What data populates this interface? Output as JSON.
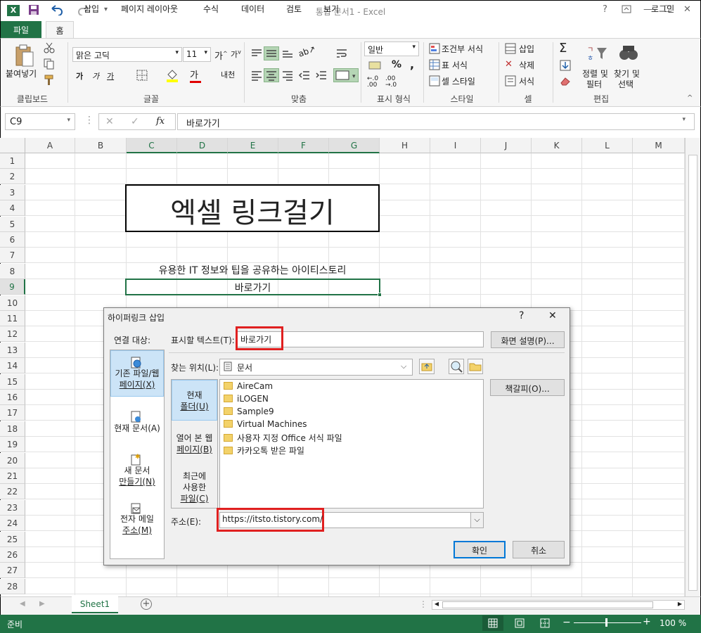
{
  "app": {
    "title": "통합 문서1 - Excel",
    "signin": "로그인"
  },
  "tabs": [
    "파일",
    "홈",
    "삽입",
    "페이지 레이아웃",
    "수식",
    "데이터",
    "검토",
    "보기"
  ],
  "ribbon": {
    "paste": "붙여넣기",
    "clipboard": "클립보드",
    "font_name": "맑은 고딕",
    "font_size": "11",
    "font_group": "글꼴",
    "align_group": "맞춤",
    "number_format": "일반",
    "number_group": "표시 형식",
    "cond_format": "조건부 서식",
    "table_format": "표 서식",
    "cell_style": "셀 스타일",
    "style_group": "스타일",
    "insert": "삽입",
    "delete": "삭제",
    "format": "서식",
    "cell_group": "셀",
    "sort_filter_1": "정렬 및",
    "sort_filter_2": "필터",
    "find_1": "찾기 및",
    "find_2": "선택",
    "edit_group": "편집",
    "bold": "가",
    "italic": "가",
    "underline": "가",
    "percent": "%",
    "comma": ","
  },
  "formula_bar": {
    "name_box": "C9",
    "fx": "fx",
    "content": "바로가기"
  },
  "columns": [
    "A",
    "B",
    "C",
    "D",
    "E",
    "F",
    "G",
    "H",
    "I",
    "J",
    "K",
    "L",
    "M"
  ],
  "rows": [
    "1",
    "2",
    "3",
    "4",
    "5",
    "6",
    "7",
    "8",
    "9",
    "10",
    "11",
    "12",
    "13",
    "14",
    "15",
    "16",
    "17",
    "18",
    "19",
    "20",
    "21",
    "22",
    "23",
    "24",
    "25",
    "26",
    "27",
    "28"
  ],
  "cells": {
    "title": "엑셀 링크걸기",
    "row8": "유용한 IT 정보와 팁을 공유하는 아이티스토리",
    "c9": "바로가기"
  },
  "sheet": {
    "name": "Sheet1"
  },
  "status": {
    "ready": "준비",
    "zoom": "100 %"
  },
  "dialog": {
    "title": "하이퍼링크 삽입",
    "help": "?",
    "close": "✕",
    "link_to": "연결 대상:",
    "nav": [
      {
        "l1": "기존 파일/웹",
        "l2": "페이지(X)"
      },
      {
        "l1": "현재 문서(A)",
        "l2": ""
      },
      {
        "l1": "새 문서",
        "l2": "만들기(N)"
      },
      {
        "l1": "전자 메일",
        "l2": "주소(M)"
      }
    ],
    "display_label": "표시할 텍스트(T):",
    "display_value": "바로가기",
    "screentip": "화면 설명(P)...",
    "look_in_label": "찾는 위치(L):",
    "look_in_value": "문서",
    "bookmark": "책갈피(O)...",
    "mid_nav": [
      {
        "l1": "현재",
        "l2": "폴더(U)",
        "l3": ""
      },
      {
        "l1": "열어 본 웹",
        "l2": "페이지(B)",
        "l3": ""
      },
      {
        "l1": "최근에",
        "l2": "사용한",
        "l3": "파일(C)"
      }
    ],
    "files": [
      "AireCam",
      "iLOGEN",
      "Sample9",
      "Virtual Machines",
      "사용자 지정 Office 서식 파일",
      "카카오톡 받은 파일"
    ],
    "address_label": "주소(E):",
    "address_value": "https://itsto.tistory.com/",
    "ok": "확인",
    "cancel": "취소"
  },
  "colors": {
    "excel_green": "#217346",
    "highlight_red": "#e02020"
  }
}
